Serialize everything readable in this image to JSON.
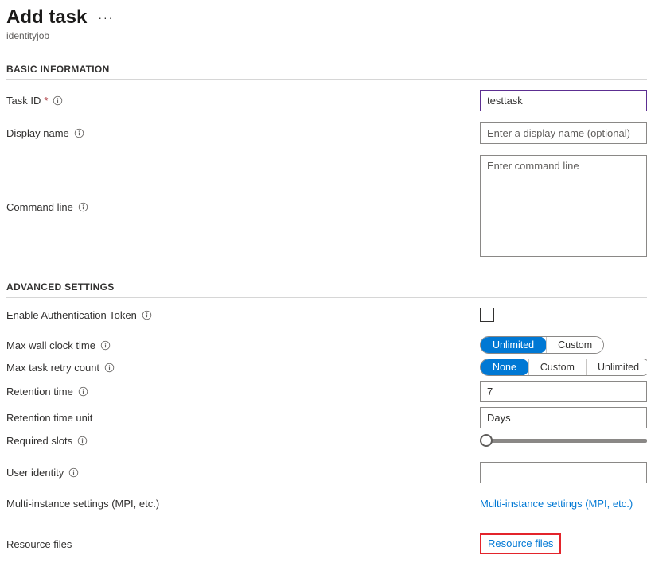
{
  "header": {
    "title": "Add task",
    "subtitle": "identityjob",
    "more_icon": "more-horizontal"
  },
  "sections": {
    "basic": {
      "title": "BASIC INFORMATION"
    },
    "advanced": {
      "title": "ADVANCED SETTINGS"
    }
  },
  "basic": {
    "task_id": {
      "label": "Task ID",
      "required_mark": "*",
      "value": "testtask"
    },
    "display_name": {
      "label": "Display name",
      "placeholder": "Enter a display name (optional)",
      "value": ""
    },
    "command_line": {
      "label": "Command line",
      "placeholder": "Enter command line",
      "value": ""
    }
  },
  "advanced": {
    "auth_token": {
      "label": "Enable Authentication Token",
      "checked": false
    },
    "max_wall_clock": {
      "label": "Max wall clock time",
      "options": [
        "Unlimited",
        "Custom"
      ],
      "selected": "Unlimited"
    },
    "max_retry": {
      "label": "Max task retry count",
      "options": [
        "None",
        "Custom",
        "Unlimited"
      ],
      "selected": "None"
    },
    "retention_time": {
      "label": "Retention time",
      "value": "7"
    },
    "retention_unit": {
      "label": "Retention time unit",
      "value": "Days"
    },
    "required_slots": {
      "label": "Required slots",
      "value": 1
    },
    "user_identity": {
      "label": "User identity",
      "value": ""
    },
    "multi_instance": {
      "label": "Multi-instance settings (MPI, etc.)",
      "link": "Multi-instance settings (MPI, etc.)"
    },
    "resource_files": {
      "label": "Resource files",
      "link": "Resource files"
    }
  }
}
